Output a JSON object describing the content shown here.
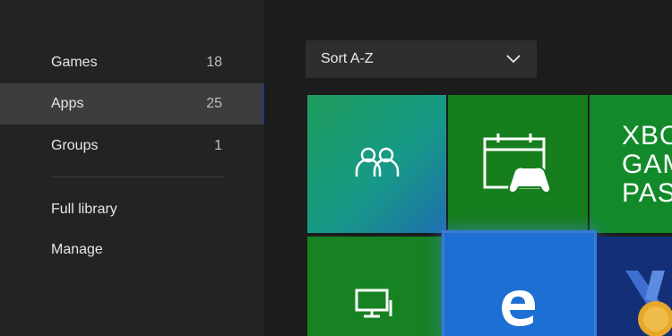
{
  "sidebar": {
    "items": [
      {
        "label": "Games",
        "count": "18"
      },
      {
        "label": "Apps",
        "count": "25"
      },
      {
        "label": "Groups",
        "count": "1"
      }
    ],
    "links": [
      {
        "label": "Full library"
      },
      {
        "label": "Manage"
      }
    ]
  },
  "sort": {
    "label": "Sort A-Z"
  },
  "tiles": [
    {
      "icon": "people-icon"
    },
    {
      "icon": "calendar-controller-icon"
    },
    {
      "text_lines": [
        "XBO",
        "GAM",
        "PAS"
      ]
    },
    {
      "icon": "monitor-icon"
    },
    {
      "icon": "edge-browser-icon"
    },
    {
      "icon": "medal-icon"
    }
  ],
  "colors": {
    "background": "#1c1c1c",
    "sidebar": "#232323",
    "selected": "#3d3d3d",
    "tile_green": "#167e1c",
    "tile_blue": "#1d6fd4",
    "tile_navy": "#132f78"
  }
}
